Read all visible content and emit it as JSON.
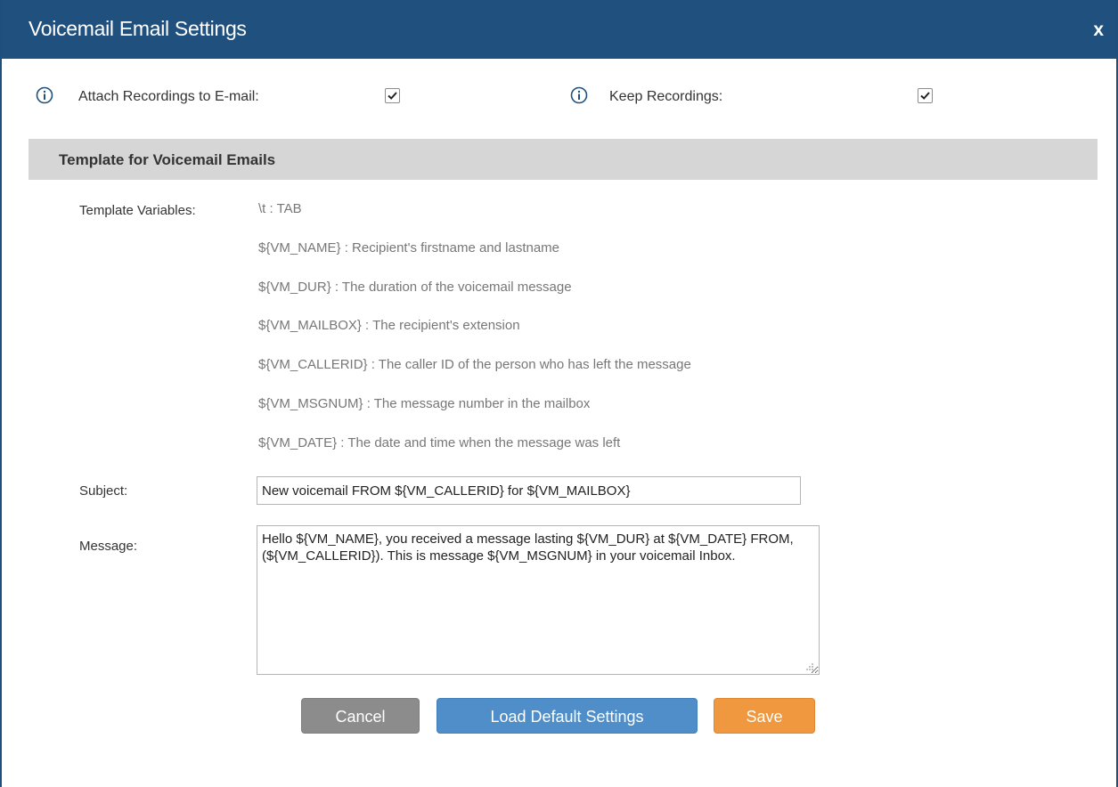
{
  "dialog": {
    "title": "Voicemail Email Settings",
    "close_label": "x"
  },
  "options": {
    "attach": {
      "label": "Attach Recordings to E-mail:",
      "checked": true,
      "icon": "info-icon"
    },
    "keep": {
      "label": "Keep Recordings:",
      "checked": true,
      "icon": "info-icon"
    }
  },
  "section": {
    "title": "Template for Voicemail Emails"
  },
  "template": {
    "label": "Template Variables:",
    "variables": [
      "\\t : TAB",
      "${VM_NAME} : Recipient's firstname and lastname",
      "${VM_DUR} : The duration of the voicemail message",
      "${VM_MAILBOX} : The recipient's extension",
      "${VM_CALLERID} : The caller ID of the person who has left the message",
      "${VM_MSGNUM} : The message number in the mailbox",
      "${VM_DATE} : The date and time when the message was left"
    ]
  },
  "subject": {
    "label": "Subject:",
    "value": "New voicemail FROM ${VM_CALLERID} for ${VM_MAILBOX}"
  },
  "message": {
    "label": "Message:",
    "value": "Hello ${VM_NAME}, you received a message lasting ${VM_DUR} at ${VM_DATE} FROM, (${VM_CALLERID}). This is message ${VM_MSGNUM} in your voicemail Inbox."
  },
  "buttons": {
    "cancel": "Cancel",
    "load_default": "Load Default Settings",
    "save": "Save"
  },
  "colors": {
    "titlebar": "#20517e",
    "section_bg": "#d6d6d6",
    "cancel": "#8c8c8c",
    "load_default": "#4f8ec9",
    "save": "#ef9840"
  }
}
